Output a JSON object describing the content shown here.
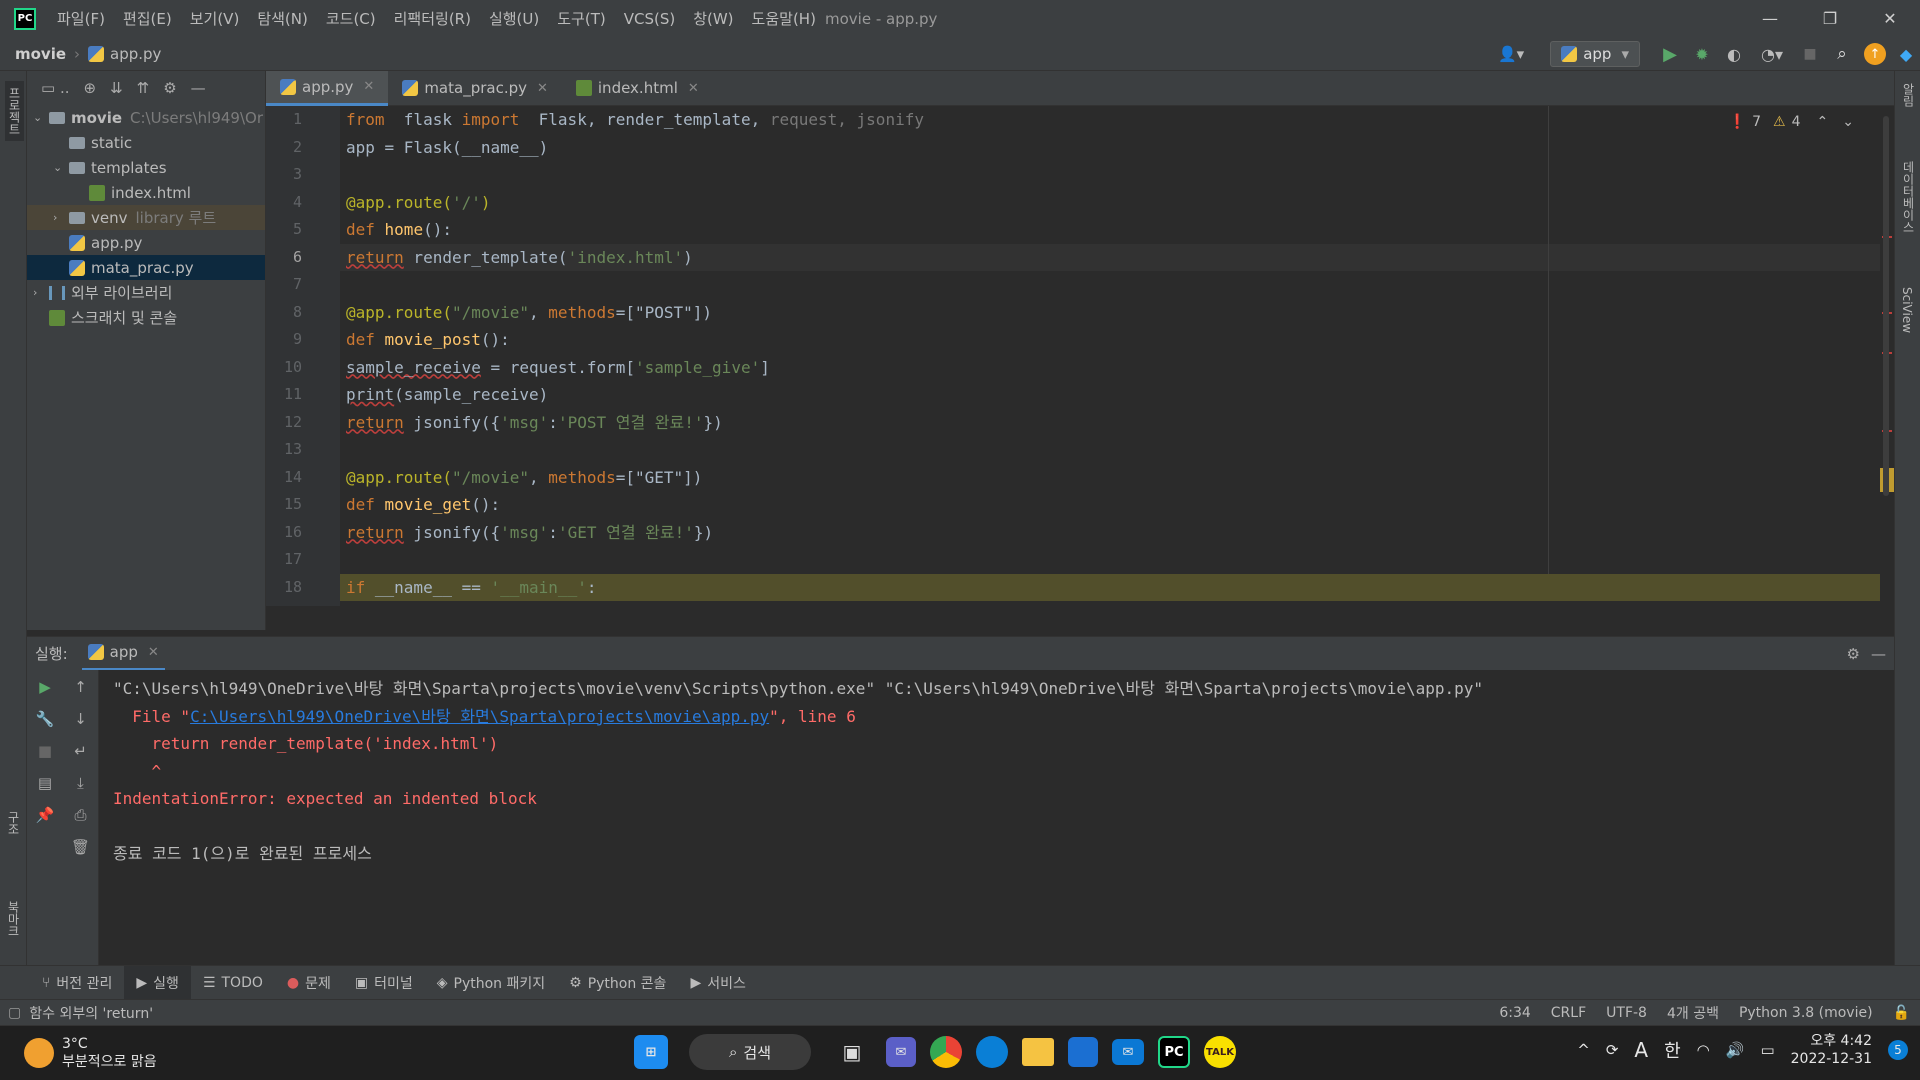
{
  "window": {
    "title": "movie - app.py",
    "menu": [
      "파일(F)",
      "편집(E)",
      "보기(V)",
      "탐색(N)",
      "코드(C)",
      "리팩터링(R)",
      "실행(U)",
      "도구(T)",
      "VCS(S)",
      "창(W)",
      "도움말(H)"
    ],
    "controls": [
      "—",
      "❐",
      "✕"
    ]
  },
  "nav": {
    "project": "movie",
    "file": "app.py",
    "run_config": "app"
  },
  "left_strip": {
    "project": "프로젝트",
    "structure": "구조",
    "bookmarks": "북마크"
  },
  "right_strip": {
    "notifications": "알림",
    "database": "데이터베이스",
    "sciview": "SciView"
  },
  "project_tree": [
    {
      "label": "movie",
      "hint": "C:\\Users\\hl949\\Or",
      "arrow": "⌄",
      "kind": "folder",
      "depth": 0,
      "bold": true
    },
    {
      "label": "static",
      "hint": "",
      "arrow": "",
      "kind": "folder",
      "depth": 1
    },
    {
      "label": "templates",
      "hint": "",
      "arrow": "⌄",
      "kind": "folder",
      "depth": 1
    },
    {
      "label": "index.html",
      "hint": "",
      "arrow": "",
      "kind": "html",
      "depth": 2
    },
    {
      "label": "venv",
      "hint": "library 루트",
      "arrow": "›",
      "kind": "folder",
      "depth": 1,
      "state": "hl"
    },
    {
      "label": "app.py",
      "hint": "",
      "arrow": "",
      "kind": "py",
      "depth": 1
    },
    {
      "label": "mata_prac.py",
      "hint": "",
      "arrow": "",
      "kind": "py",
      "depth": 1,
      "state": "sel"
    },
    {
      "label": "외부 라이브러리",
      "hint": "",
      "arrow": "›",
      "kind": "lib",
      "depth": 0
    },
    {
      "label": "스크래치 및 콘솔",
      "hint": "",
      "arrow": "",
      "kind": "scratch",
      "depth": 0
    }
  ],
  "tabs": [
    {
      "label": "app.py",
      "kind": "py",
      "active": true
    },
    {
      "label": "mata_prac.py",
      "kind": "py",
      "active": false
    },
    {
      "label": "index.html",
      "kind": "html",
      "active": false
    }
  ],
  "inspections": {
    "errors": "7",
    "warnings": "4"
  },
  "editor": {
    "current_line": 6,
    "lines": [
      {
        "n": "1",
        "tokens": [
          [
            "kw",
            "from"
          ],
          [
            "",
            "  flask "
          ],
          [
            "kw",
            "import"
          ],
          [
            "",
            "  Flask, render_template, "
          ],
          [
            "gr",
            "request, jsonify"
          ]
        ]
      },
      {
        "n": "2",
        "tokens": [
          [
            "",
            "app = Flask(__name__)"
          ]
        ]
      },
      {
        "n": "3",
        "tokens": []
      },
      {
        "n": "4",
        "tokens": [
          [
            "dec",
            "@app.route("
          ],
          [
            "str",
            "'/'"
          ],
          [
            "dec",
            ")"
          ]
        ]
      },
      {
        "n": "5",
        "tokens": [
          [
            "kw",
            "def"
          ],
          [
            "",
            ""
          ],
          [
            "fn",
            " home"
          ],
          [
            "",
            "():"
          ]
        ]
      },
      {
        "n": "6",
        "tokens": [
          [
            "kw err",
            "return"
          ],
          [
            "",
            " render_template("
          ],
          [
            "str",
            "'index.html'"
          ],
          [
            "",
            ")"
          ]
        ]
      },
      {
        "n": "7",
        "tokens": []
      },
      {
        "n": "8",
        "tokens": [
          [
            "dec",
            "@app.route("
          ],
          [
            "str",
            "\"/movie\""
          ],
          [
            "",
            ", "
          ],
          [
            "kw",
            "methods"
          ],
          [
            "",
            "=[\"POST\"])"
          ]
        ]
      },
      {
        "n": "9",
        "tokens": [
          [
            "kw",
            "def"
          ],
          [
            "fn",
            " movie_post"
          ],
          [
            "",
            "():"
          ]
        ]
      },
      {
        "n": "10",
        "tokens": [
          [
            "err",
            "sample_receive"
          ],
          [
            "",
            " = request.form["
          ],
          [
            "str",
            "'sample_give'"
          ],
          [
            "",
            "]"
          ]
        ]
      },
      {
        "n": "11",
        "tokens": [
          [
            "err",
            "print"
          ],
          [
            "",
            "(sample_receive)"
          ]
        ]
      },
      {
        "n": "12",
        "tokens": [
          [
            "kw err",
            "return"
          ],
          [
            "",
            " jsonify({"
          ],
          [
            "str",
            "'msg'"
          ],
          [
            "",
            ":"
          ],
          [
            "str",
            "'POST 연결 완료!'"
          ],
          [
            "",
            "})"
          ]
        ]
      },
      {
        "n": "13",
        "tokens": []
      },
      {
        "n": "14",
        "tokens": [
          [
            "dec",
            "@app.route("
          ],
          [
            "str",
            "\"/movie\""
          ],
          [
            "",
            ", "
          ],
          [
            "kw",
            "methods"
          ],
          [
            "",
            "=[\"GET\"])"
          ]
        ]
      },
      {
        "n": "15",
        "tokens": [
          [
            "kw",
            "def"
          ],
          [
            "fn",
            " movie_get"
          ],
          [
            "",
            "():"
          ]
        ]
      },
      {
        "n": "16",
        "tokens": [
          [
            "kw err",
            "return"
          ],
          [
            "",
            " jsonify({"
          ],
          [
            "str",
            "'msg'"
          ],
          [
            "",
            ":"
          ],
          [
            "str",
            "'GET 연결 완료!'"
          ],
          [
            "",
            "})"
          ]
        ]
      },
      {
        "n": "17",
        "tokens": []
      },
      {
        "n": "18",
        "tokens": [
          [
            "kw",
            "if"
          ],
          [
            "",
            " __name__ == "
          ],
          [
            "str",
            "'__main__'"
          ],
          [
            "",
            ":"
          ]
        ]
      }
    ]
  },
  "run": {
    "label": "실행:",
    "tab": "app",
    "console": [
      {
        "cls": "",
        "text": "\"C:\\Users\\hl949\\OneDrive\\바탕 화면\\Sparta\\projects\\movie\\venv\\Scripts\\python.exe\" \"C:\\Users\\hl949\\OneDrive\\바탕 화면\\Sparta\\projects\\movie\\app.py\""
      },
      {
        "cls": "red",
        "text": "  File \"",
        "link": "C:\\Users\\hl949\\OneDrive\\바탕 화면\\Sparta\\projects\\movie\\app.py",
        "after": "\", line 6"
      },
      {
        "cls": "red",
        "text": "    return render_template('index.html')"
      },
      {
        "cls": "red",
        "text": "    ^"
      },
      {
        "cls": "red",
        "text": "IndentationError: expected an indented block"
      },
      {
        "cls": "",
        "text": ""
      },
      {
        "cls": "",
        "text": "종료 코드 1(으)로 완료된 프로세스"
      }
    ]
  },
  "bottom_tools": [
    {
      "label": "버전 관리",
      "icon": "⑂"
    },
    {
      "label": "실행",
      "icon": "▶",
      "active": true
    },
    {
      "label": "TODO",
      "icon": "☰"
    },
    {
      "label": "문제",
      "icon": "●"
    },
    {
      "label": "터미널",
      "icon": "▣"
    },
    {
      "label": "Python 패키지",
      "icon": "◈"
    },
    {
      "label": "Python 콘솔",
      "icon": "⚙"
    },
    {
      "label": "서비스",
      "icon": "▶"
    }
  ],
  "status": {
    "message": "함수 외부의 'return'",
    "position": "6:34",
    "line_sep": "CRLF",
    "encoding": "UTF-8",
    "indent": "4개 공백",
    "interpreter": "Python 3.8 (movie)"
  },
  "taskbar": {
    "weather_temp": "3°C",
    "weather_desc": "부분적으로 맑음",
    "search": "검색",
    "ime": "A",
    "lang": "한",
    "time": "오후 4:42",
    "date": "2022-12-31",
    "notif_count": "5"
  },
  "colors": {
    "accent": "#4a88c7",
    "error": "#ff6b68",
    "link": "#287bde"
  }
}
